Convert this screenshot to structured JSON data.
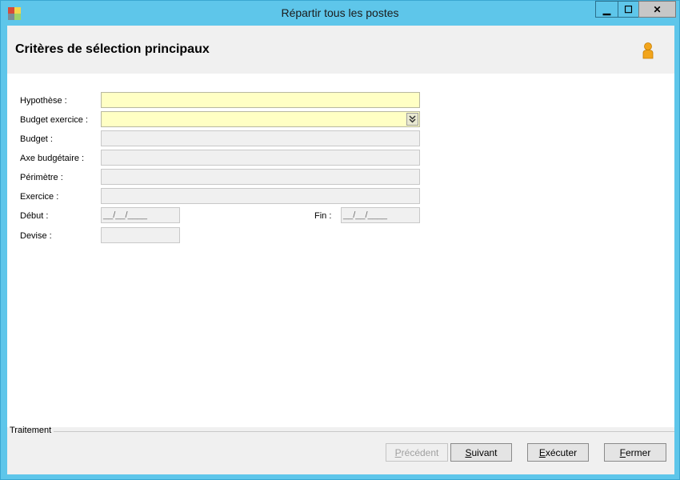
{
  "window": {
    "title": "Répartir tous les postes",
    "minimize_glyph": "▁",
    "maximize_glyph": "☐",
    "close_glyph": "✕"
  },
  "header": {
    "title": "Critères de sélection principaux",
    "user_icon": "user-icon"
  },
  "form": {
    "hypothese": {
      "label": "Hypothèse :",
      "value": ""
    },
    "budget_exercice": {
      "label": "Budget exercice :",
      "value": ""
    },
    "budget": {
      "label": "Budget :",
      "value": ""
    },
    "axe": {
      "label": "Axe budgétaire :",
      "value": ""
    },
    "perimetre": {
      "label": "Périmètre :",
      "value": ""
    },
    "exercice": {
      "label": "Exercice :",
      "value": ""
    },
    "debut": {
      "label": "Début :",
      "value": "__/__/____"
    },
    "fin": {
      "label": "Fin :",
      "value": "__/__/____"
    },
    "devise": {
      "label": "Devise :",
      "value": ""
    }
  },
  "footer": {
    "group_label": "Traitement",
    "buttons": {
      "precedent": {
        "first": "P",
        "rest": "récédent"
      },
      "suivant": {
        "first": "S",
        "rest": "uivant"
      },
      "executer": {
        "first": "E",
        "rest": "xécuter"
      },
      "fermer": {
        "first": "F",
        "rest": "ermer"
      }
    }
  },
  "colors": {
    "titlebar": "#5ec6ea",
    "required_field": "#ffffc4",
    "disabled_field": "#f0f0f0"
  }
}
